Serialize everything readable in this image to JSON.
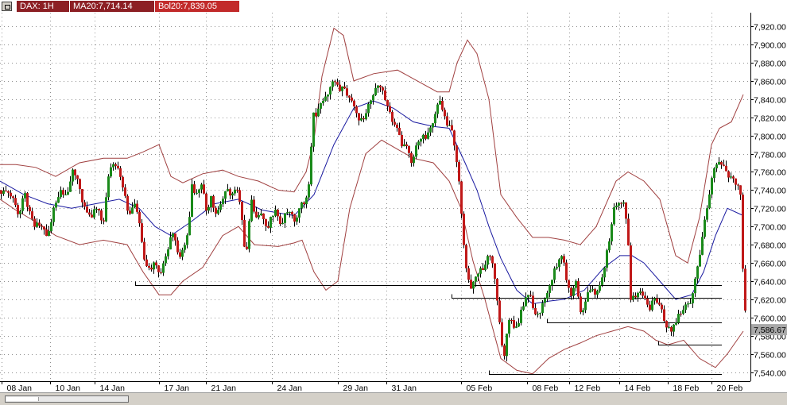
{
  "header": {
    "symbol_label": "DAX: 1H",
    "ma_label": "MA20:7,714.14",
    "bol_label": "Bol20:7,839.05"
  },
  "chart_data": {
    "type": "candlestick",
    "title": "",
    "y_tick_labels": [
      "7,540.00",
      "7,560.00",
      "7,580.00",
      "7,600.00",
      "7,620.00",
      "7,640.00",
      "7,660.00",
      "7,680.00",
      "7,700.00",
      "7,720.00",
      "7,740.00",
      "7,760.00",
      "7,780.00",
      "7,800.00",
      "7,820.00",
      "7,840.00",
      "7,860.00",
      "7,880.00",
      "7,900.00",
      "7,920.00"
    ],
    "x_tick_labels": [
      "08 Jan",
      "10 Jan",
      "14 Jan",
      "17 Jan",
      "21 Jan",
      "24 Jan",
      "29 Jan",
      "31 Jan",
      "05 Feb",
      "08 Feb",
      "12 Feb",
      "14 Feb",
      "18 Feb",
      "20 Feb"
    ],
    "ylim": [
      7530,
      7935
    ],
    "grid": true,
    "last_price_label": "7,586.67",
    "last_price": 7586.67,
    "colors": {
      "up": "#1a8a1a",
      "down": "#c01818",
      "ma": "#1a1aa0",
      "bands": "#a04040",
      "grid": "#909090"
    },
    "support_levels": [
      {
        "price": 7636,
        "from_bar": 170,
        "to_bar": 908
      },
      {
        "price": 7622,
        "from_bar": 568,
        "to_bar": 908
      },
      {
        "price": 7595,
        "from_bar": 688,
        "to_bar": 908
      },
      {
        "price": 7570,
        "from_bar": 828,
        "to_bar": 908
      },
      {
        "price": 7538,
        "from_bar": 615,
        "to_bar": 908
      }
    ],
    "close_path": [
      [
        0,
        7740
      ],
      [
        14,
        7735
      ],
      [
        22,
        7710
      ],
      [
        28,
        7740
      ],
      [
        35,
        7715
      ],
      [
        42,
        7700
      ],
      [
        50,
        7705
      ],
      [
        58,
        7690
      ],
      [
        66,
        7720
      ],
      [
        74,
        7740
      ],
      [
        82,
        7735
      ],
      [
        90,
        7760
      ],
      [
        98,
        7745
      ],
      [
        106,
        7715
      ],
      [
        114,
        7710
      ],
      [
        122,
        7725
      ],
      [
        128,
        7700
      ],
      [
        136,
        7760
      ],
      [
        144,
        7770
      ],
      [
        152,
        7745
      ],
      [
        160,
        7715
      ],
      [
        168,
        7725
      ],
      [
        175,
        7700
      ],
      [
        180,
        7660
      ],
      [
        185,
        7650
      ],
      [
        192,
        7660
      ],
      [
        200,
        7650
      ],
      [
        206,
        7660
      ],
      [
        212,
        7685
      ],
      [
        218,
        7690
      ],
      [
        224,
        7665
      ],
      [
        230,
        7675
      ],
      [
        236,
        7700
      ],
      [
        240,
        7745
      ],
      [
        246,
        7735
      ],
      [
        252,
        7745
      ],
      [
        258,
        7720
      ],
      [
        264,
        7730
      ],
      [
        270,
        7715
      ],
      [
        276,
        7725
      ],
      [
        282,
        7740
      ],
      [
        290,
        7735
      ],
      [
        298,
        7745
      ],
      [
        304,
        7700
      ],
      [
        308,
        7660
      ],
      [
        314,
        7730
      ],
      [
        320,
        7705
      ],
      [
        326,
        7715
      ],
      [
        334,
        7695
      ],
      [
        340,
        7710
      ],
      [
        346,
        7720
      ],
      [
        352,
        7700
      ],
      [
        358,
        7715
      ],
      [
        364,
        7720
      ],
      [
        370,
        7700
      ],
      [
        376,
        7720
      ],
      [
        382,
        7730
      ],
      [
        388,
        7745
      ],
      [
        392,
        7830
      ],
      [
        396,
        7820
      ],
      [
        402,
        7835
      ],
      [
        408,
        7840
      ],
      [
        414,
        7855
      ],
      [
        420,
        7860
      ],
      [
        426,
        7848
      ],
      [
        432,
        7855
      ],
      [
        438,
        7840
      ],
      [
        444,
        7830
      ],
      [
        450,
        7815
      ],
      [
        456,
        7820
      ],
      [
        462,
        7835
      ],
      [
        468,
        7845
      ],
      [
        474,
        7855
      ],
      [
        480,
        7848
      ],
      [
        486,
        7830
      ],
      [
        492,
        7815
      ],
      [
        498,
        7810
      ],
      [
        504,
        7790
      ],
      [
        510,
        7785
      ],
      [
        516,
        7770
      ],
      [
        522,
        7790
      ],
      [
        528,
        7800
      ],
      [
        534,
        7795
      ],
      [
        540,
        7810
      ],
      [
        546,
        7825
      ],
      [
        550,
        7840
      ],
      [
        556,
        7825
      ],
      [
        562,
        7810
      ],
      [
        568,
        7805
      ],
      [
        572,
        7780
      ],
      [
        576,
        7750
      ],
      [
        580,
        7700
      ],
      [
        584,
        7660
      ],
      [
        590,
        7630
      ],
      [
        596,
        7640
      ],
      [
        602,
        7650
      ],
      [
        608,
        7655
      ],
      [
        614,
        7670
      ],
      [
        620,
        7655
      ],
      [
        624,
        7620
      ],
      [
        628,
        7590
      ],
      [
        632,
        7545
      ],
      [
        636,
        7580
      ],
      [
        640,
        7600
      ],
      [
        646,
        7585
      ],
      [
        652,
        7600
      ],
      [
        658,
        7615
      ],
      [
        664,
        7630
      ],
      [
        670,
        7610
      ],
      [
        676,
        7600
      ],
      [
        682,
        7620
      ],
      [
        688,
        7630
      ],
      [
        694,
        7645
      ],
      [
        700,
        7660
      ],
      [
        706,
        7665
      ],
      [
        712,
        7640
      ],
      [
        718,
        7625
      ],
      [
        724,
        7640
      ],
      [
        730,
        7600
      ],
      [
        736,
        7625
      ],
      [
        742,
        7630
      ],
      [
        748,
        7625
      ],
      [
        754,
        7640
      ],
      [
        760,
        7660
      ],
      [
        766,
        7690
      ],
      [
        772,
        7725
      ],
      [
        778,
        7730
      ],
      [
        784,
        7725
      ],
      [
        788,
        7700
      ],
      [
        792,
        7620
      ],
      [
        798,
        7625
      ],
      [
        804,
        7630
      ],
      [
        810,
        7620
      ],
      [
        816,
        7610
      ],
      [
        822,
        7625
      ],
      [
        828,
        7615
      ],
      [
        834,
        7600
      ],
      [
        838,
        7590
      ],
      [
        844,
        7585
      ],
      [
        850,
        7600
      ],
      [
        856,
        7605
      ],
      [
        862,
        7615
      ],
      [
        868,
        7620
      ],
      [
        872,
        7640
      ],
      [
        878,
        7665
      ],
      [
        884,
        7705
      ],
      [
        890,
        7730
      ],
      [
        896,
        7760
      ],
      [
        902,
        7775
      ],
      [
        908,
        7765
      ],
      [
        914,
        7755
      ],
      [
        920,
        7750
      ],
      [
        926,
        7745
      ],
      [
        930,
        7735
      ],
      [
        932,
        7685
      ],
      [
        934,
        7620
      ],
      [
        936,
        7610
      ]
    ],
    "ma_path": [
      [
        0,
        7750
      ],
      [
        30,
        7735
      ],
      [
        60,
        7725
      ],
      [
        90,
        7720
      ],
      [
        120,
        7725
      ],
      [
        150,
        7730
      ],
      [
        175,
        7720
      ],
      [
        195,
        7700
      ],
      [
        215,
        7690
      ],
      [
        240,
        7705
      ],
      [
        270,
        7725
      ],
      [
        300,
        7730
      ],
      [
        330,
        7718
      ],
      [
        370,
        7712
      ],
      [
        395,
        7735
      ],
      [
        420,
        7790
      ],
      [
        445,
        7830
      ],
      [
        470,
        7838
      ],
      [
        495,
        7830
      ],
      [
        520,
        7815
      ],
      [
        545,
        7810
      ],
      [
        565,
        7808
      ],
      [
        585,
        7770
      ],
      [
        600,
        7740
      ],
      [
        615,
        7700
      ],
      [
        630,
        7665
      ],
      [
        650,
        7630
      ],
      [
        670,
        7615
      ],
      [
        690,
        7618
      ],
      [
        710,
        7620
      ],
      [
        735,
        7630
      ],
      [
        760,
        7655
      ],
      [
        780,
        7668
      ],
      [
        795,
        7668
      ],
      [
        810,
        7660
      ],
      [
        830,
        7640
      ],
      [
        850,
        7620
      ],
      [
        870,
        7625
      ],
      [
        885,
        7650
      ],
      [
        900,
        7690
      ],
      [
        915,
        7720
      ],
      [
        935,
        7712
      ]
    ],
    "upper_band_path": [
      [
        0,
        7768
      ],
      [
        20,
        7768
      ],
      [
        45,
        7765
      ],
      [
        70,
        7755
      ],
      [
        100,
        7770
      ],
      [
        130,
        7775
      ],
      [
        160,
        7775
      ],
      [
        180,
        7782
      ],
      [
        200,
        7790
      ],
      [
        215,
        7755
      ],
      [
        230,
        7748
      ],
      [
        255,
        7758
      ],
      [
        280,
        7762
      ],
      [
        300,
        7755
      ],
      [
        325,
        7750
      ],
      [
        350,
        7740
      ],
      [
        370,
        7738
      ],
      [
        385,
        7760
      ],
      [
        395,
        7795
      ],
      [
        405,
        7865
      ],
      [
        420,
        7918
      ],
      [
        432,
        7910
      ],
      [
        445,
        7860
      ],
      [
        470,
        7868
      ],
      [
        500,
        7872
      ],
      [
        525,
        7860
      ],
      [
        550,
        7848
      ],
      [
        565,
        7848
      ],
      [
        575,
        7880
      ],
      [
        588,
        7905
      ],
      [
        600,
        7890
      ],
      [
        615,
        7840
      ],
      [
        630,
        7735
      ],
      [
        650,
        7710
      ],
      [
        670,
        7688
      ],
      [
        690,
        7688
      ],
      [
        710,
        7685
      ],
      [
        730,
        7680
      ],
      [
        750,
        7700
      ],
      [
        775,
        7750
      ],
      [
        790,
        7760
      ],
      [
        810,
        7750
      ],
      [
        830,
        7730
      ],
      [
        850,
        7668
      ],
      [
        865,
        7660
      ],
      [
        880,
        7710
      ],
      [
        895,
        7790
      ],
      [
        905,
        7808
      ],
      [
        920,
        7815
      ],
      [
        935,
        7845
      ]
    ],
    "lower_band_path": [
      [
        0,
        7730
      ],
      [
        20,
        7718
      ],
      [
        45,
        7705
      ],
      [
        70,
        7690
      ],
      [
        100,
        7680
      ],
      [
        130,
        7685
      ],
      [
        160,
        7680
      ],
      [
        180,
        7650
      ],
      [
        200,
        7625
      ],
      [
        215,
        7625
      ],
      [
        230,
        7640
      ],
      [
        255,
        7655
      ],
      [
        280,
        7690
      ],
      [
        300,
        7700
      ],
      [
        320,
        7680
      ],
      [
        350,
        7678
      ],
      [
        370,
        7682
      ],
      [
        380,
        7685
      ],
      [
        395,
        7650
      ],
      [
        410,
        7630
      ],
      [
        425,
        7640
      ],
      [
        440,
        7720
      ],
      [
        460,
        7780
      ],
      [
        480,
        7795
      ],
      [
        500,
        7785
      ],
      [
        520,
        7775
      ],
      [
        545,
        7770
      ],
      [
        565,
        7750
      ],
      [
        580,
        7720
      ],
      [
        595,
        7662
      ],
      [
        610,
        7620
      ],
      [
        630,
        7555
      ],
      [
        650,
        7542
      ],
      [
        670,
        7538
      ],
      [
        690,
        7555
      ],
      [
        710,
        7565
      ],
      [
        730,
        7572
      ],
      [
        750,
        7580
      ],
      [
        770,
        7585
      ],
      [
        790,
        7590
      ],
      [
        810,
        7585
      ],
      [
        825,
        7575
      ],
      [
        840,
        7570
      ],
      [
        860,
        7575
      ],
      [
        880,
        7555
      ],
      [
        900,
        7545
      ],
      [
        915,
        7560
      ],
      [
        935,
        7585
      ]
    ]
  }
}
